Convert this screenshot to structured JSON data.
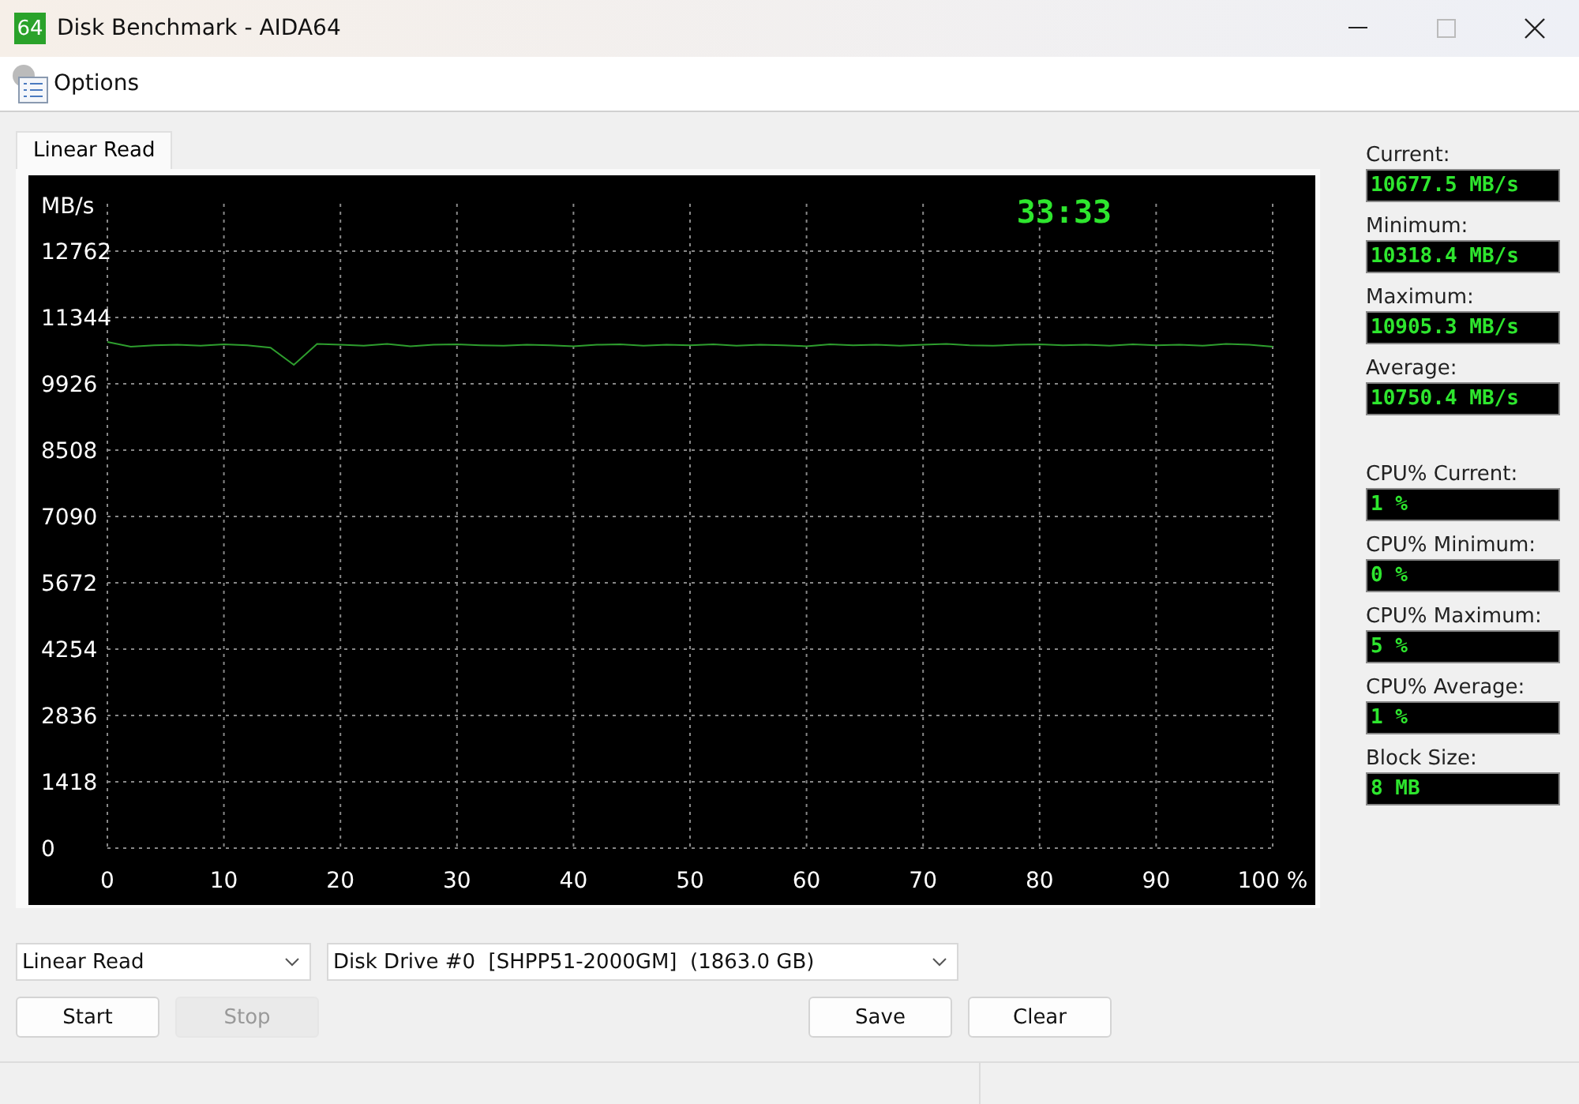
{
  "window": {
    "icon_text": "64",
    "title": "Disk Benchmark - AIDA64"
  },
  "menu": [
    {
      "label": "Options"
    }
  ],
  "tabs": [
    {
      "label": "Linear Read",
      "selected": true
    }
  ],
  "chart": {
    "timer": "33:33",
    "chart_data": {
      "type": "line",
      "ylabel": "MB/s",
      "x": [
        0,
        2,
        4,
        6,
        8,
        10,
        12,
        14,
        16,
        18,
        20,
        22,
        24,
        26,
        28,
        30,
        32,
        34,
        36,
        38,
        40,
        42,
        44,
        46,
        48,
        50,
        52,
        54,
        56,
        58,
        60,
        62,
        64,
        66,
        68,
        70,
        72,
        74,
        76,
        78,
        80,
        82,
        84,
        86,
        88,
        90,
        92,
        94,
        96,
        98,
        100
      ],
      "grid": true,
      "series": [
        {
          "color": "#2e9e2e",
          "values": [
            10820,
            10720,
            10750,
            10760,
            10740,
            10770,
            10750,
            10700,
            10330,
            10780,
            10760,
            10740,
            10780,
            10730,
            10760,
            10770,
            10750,
            10740,
            10760,
            10750,
            10730,
            10760,
            10770,
            10740,
            10760,
            10750,
            10770,
            10740,
            10760,
            10750,
            10730,
            10770,
            10750,
            10760,
            10740,
            10760,
            10780,
            10750,
            10740,
            10760,
            10770,
            10750,
            10760,
            10740,
            10770,
            10750,
            10760,
            10740,
            10780,
            10760,
            10720
          ]
        }
      ],
      "xlim": [
        0,
        100
      ],
      "ylim": [
        0,
        12762
      ],
      "xticks": [
        0,
        10,
        20,
        30,
        40,
        50,
        60,
        70,
        80,
        90,
        {
          "value": 100,
          "label": "100 %"
        }
      ],
      "yticks": [
        0,
        1418,
        2836,
        4254,
        5672,
        7090,
        8508,
        9926,
        11344,
        12762
      ]
    }
  },
  "stats": [
    {
      "label": "Current:",
      "value": "10677.5 MB/s"
    },
    {
      "label": "Minimum:",
      "value": "10318.4 MB/s"
    },
    {
      "label": "Maximum:",
      "value": "10905.3 MB/s"
    },
    {
      "label": "Average:",
      "value": "10750.4 MB/s"
    },
    {
      "label": "CPU% Current:",
      "value": "1 %"
    },
    {
      "label": "CPU% Minimum:",
      "value": "0 %"
    },
    {
      "label": "CPU% Maximum:",
      "value": "5 %"
    },
    {
      "label": "CPU% Average:",
      "value": "1 %"
    },
    {
      "label": "Block Size:",
      "value": "8 MB"
    }
  ],
  "test_select": {
    "value": "Linear Read"
  },
  "drive_select": {
    "value": "Disk Drive #0  [SHPP51-2000GM]  (1863.0 GB)"
  },
  "buttons_left": [
    {
      "label": "Start",
      "disabled": false
    },
    {
      "label": "Stop",
      "disabled": true
    }
  ],
  "buttons_right": [
    {
      "label": "Save",
      "disabled": false
    },
    {
      "label": "Clear",
      "disabled": false
    }
  ]
}
